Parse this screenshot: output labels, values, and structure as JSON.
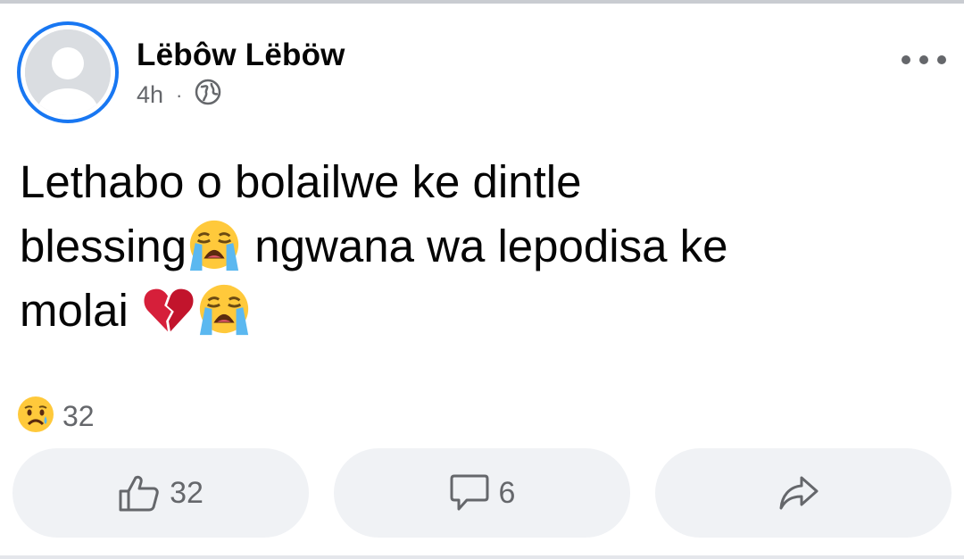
{
  "post": {
    "author": "Lëbôw Lëböw",
    "time": "4h",
    "separator": "·",
    "privacy_icon": "globe-icon",
    "more_icon": "more-dots-icon",
    "text_line1": "Lethabo o bolailwe ke dintle",
    "text_line2a": "blessing",
    "text_line2b": " ngwana wa lepodisa ke",
    "text_line3": "molai ",
    "emojis": [
      "loudly-crying-face",
      "broken-heart",
      "loudly-crying-face"
    ]
  },
  "reactions": {
    "icon": "sad-reaction-icon",
    "count": "32"
  },
  "actions": {
    "like_count": "32",
    "comment_count": "6",
    "share_icon": "share-icon"
  },
  "colors": {
    "accent": "#1877f2",
    "text": "#050505",
    "secondary": "#65676b",
    "button_bg": "#f0f2f5"
  }
}
